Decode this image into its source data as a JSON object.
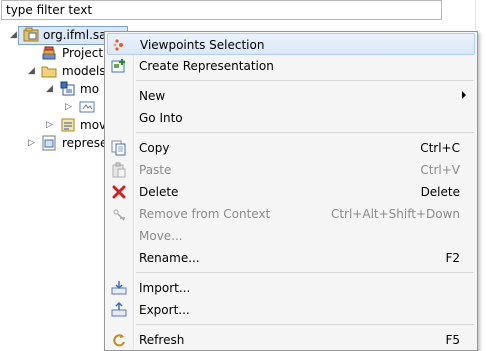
{
  "filter": {
    "value": "type filter text"
  },
  "tree": {
    "root": "org.ifml.sar",
    "project": "Project I",
    "models": "models",
    "model_child": "mo",
    "move_item": "mov",
    "represent": "represer"
  },
  "menu": {
    "items": [
      {
        "label": "Viewpoints Selection",
        "shortcut": ""
      },
      {
        "label": "Create Representation",
        "shortcut": ""
      },
      {
        "label": "New",
        "shortcut": ""
      },
      {
        "label": "Go Into",
        "shortcut": ""
      },
      {
        "label": "Copy",
        "shortcut": "Ctrl+C"
      },
      {
        "label": "Paste",
        "shortcut": "Ctrl+V"
      },
      {
        "label": "Delete",
        "shortcut": "Delete"
      },
      {
        "label": "Remove from Context",
        "shortcut": "Ctrl+Alt+Shift+Down"
      },
      {
        "label": "Move...",
        "shortcut": ""
      },
      {
        "label": "Rename...",
        "shortcut": "F2"
      },
      {
        "label": "Import...",
        "shortcut": ""
      },
      {
        "label": "Export...",
        "shortcut": ""
      },
      {
        "label": "Refresh",
        "shortcut": "F5"
      }
    ]
  },
  "colors": {
    "highlight": "#dbe8f8",
    "delete_icon": "#d02020",
    "folder": "#e8c25a"
  }
}
